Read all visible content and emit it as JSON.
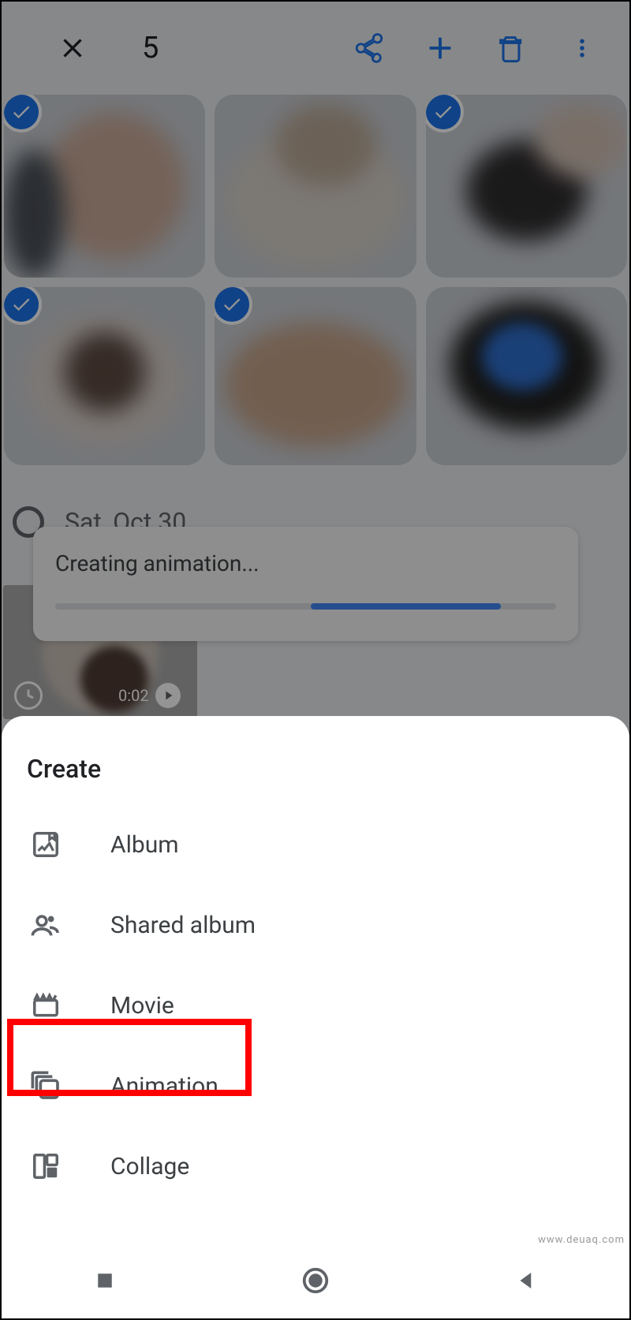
{
  "topbar": {
    "selection_count": "5"
  },
  "row1": [
    {
      "selected": true
    },
    {
      "selected": false
    },
    {
      "selected": true
    }
  ],
  "row2": [
    {
      "selected": true
    },
    {
      "selected": true
    },
    {
      "selected": false
    }
  ],
  "section_date": "Sat, Oct 30",
  "video_time": "0:02",
  "toast_text": "Creating animation...",
  "sheet": {
    "title": "Create",
    "items": [
      {
        "label": "Album"
      },
      {
        "label": "Shared album"
      },
      {
        "label": "Movie"
      },
      {
        "label": "Animation"
      },
      {
        "label": "Collage"
      }
    ]
  },
  "watermark": "www.deuaq.com"
}
